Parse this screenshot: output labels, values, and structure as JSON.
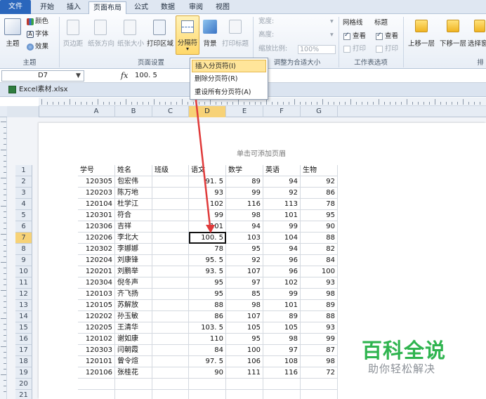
{
  "tabs": [
    "文件",
    "开始",
    "插入",
    "页面布局",
    "公式",
    "数据",
    "审阅",
    "视图"
  ],
  "ribbon": {
    "theme": {
      "main": "主题",
      "colors": "颜色",
      "fonts": "字体",
      "effects": "效果",
      "group": "主题"
    },
    "page_setup": {
      "margins": "页边距",
      "orientation": "纸张方向",
      "size": "纸张大小",
      "print_area": "打印区域",
      "breaks": "分隔符",
      "background": "背景",
      "print_titles": "打印标题",
      "group": "页面设置"
    },
    "scale": {
      "width": "宽度:",
      "height": "高度:",
      "scale": "缩放比例:",
      "scale_value": "100%",
      "group": "调整为合适大小"
    },
    "sheet_options": {
      "gridlines": "网格线",
      "headings": "标题",
      "view1": "查看",
      "view2": "查看",
      "print1": "打印",
      "print2": "打印",
      "group": "工作表选项"
    },
    "arrange": {
      "bring_forward": "上移一层",
      "send_backward": "下移一层",
      "selection": "选择窗",
      "group": "排"
    }
  },
  "dropdown": [
    "插入分页符(I)",
    "删除分页符(R)",
    "重设所有分页符(A)"
  ],
  "formula_bar": {
    "cell": "D7",
    "fx": "fx",
    "value": "100. 5"
  },
  "workbook": "Excel素材.xlsx",
  "columns": [
    "A",
    "B",
    "C",
    "D",
    "E",
    "F",
    "G"
  ],
  "header_hint": "单击可添加页眉",
  "rows": [
    "1",
    "2",
    "3",
    "4",
    "5",
    "6",
    "7",
    "8",
    "9",
    "10",
    "11",
    "12",
    "13",
    "14",
    "15",
    "16",
    "17",
    "18",
    "19",
    "20",
    "21"
  ],
  "table": {
    "headers": [
      "学号",
      "姓名",
      "班级",
      "语文",
      "数学",
      "英语",
      "生物"
    ],
    "records": [
      [
        "120305",
        "包宏伟",
        "",
        "91. 5",
        "89",
        "94",
        "92"
      ],
      [
        "120203",
        "陈万地",
        "",
        "93",
        "99",
        "92",
        "86"
      ],
      [
        "120104",
        "杜学江",
        "",
        "102",
        "116",
        "113",
        "78"
      ],
      [
        "120301",
        "符合",
        "",
        "99",
        "98",
        "101",
        "95"
      ],
      [
        "120306",
        "吉祥",
        "",
        "101",
        "94",
        "99",
        "90"
      ],
      [
        "120206",
        "李北大",
        "",
        "100. 5",
        "103",
        "104",
        "88"
      ],
      [
        "120302",
        "李娜娜",
        "",
        "78",
        "95",
        "94",
        "82"
      ],
      [
        "120204",
        "刘康锋",
        "",
        "95. 5",
        "92",
        "96",
        "84"
      ],
      [
        "120201",
        "刘鹏举",
        "",
        "93. 5",
        "107",
        "96",
        "100"
      ],
      [
        "120304",
        "倪冬声",
        "",
        "95",
        "97",
        "102",
        "93"
      ],
      [
        "120103",
        "齐飞扬",
        "",
        "95",
        "85",
        "99",
        "98"
      ],
      [
        "120105",
        "苏解放",
        "",
        "88",
        "98",
        "101",
        "89"
      ],
      [
        "120202",
        "孙玉敏",
        "",
        "86",
        "107",
        "89",
        "88"
      ],
      [
        "120205",
        "王清华",
        "",
        "103. 5",
        "105",
        "105",
        "93"
      ],
      [
        "120102",
        "谢如康",
        "",
        "110",
        "95",
        "98",
        "99"
      ],
      [
        "120303",
        "闫朝霞",
        "",
        "84",
        "100",
        "97",
        "87"
      ],
      [
        "120101",
        "曾令煊",
        "",
        "97. 5",
        "106",
        "108",
        "98"
      ],
      [
        "120106",
        "张桂花",
        "",
        "90",
        "111",
        "116",
        "72"
      ]
    ]
  },
  "watermark": {
    "title": "百科全说",
    "subtitle": "助你轻松解决"
  },
  "colors": {
    "file_tab": "#2a66bc",
    "selected": "#f7d277",
    "arrow": "#e03a3a",
    "watermark": "#2fb44f"
  }
}
